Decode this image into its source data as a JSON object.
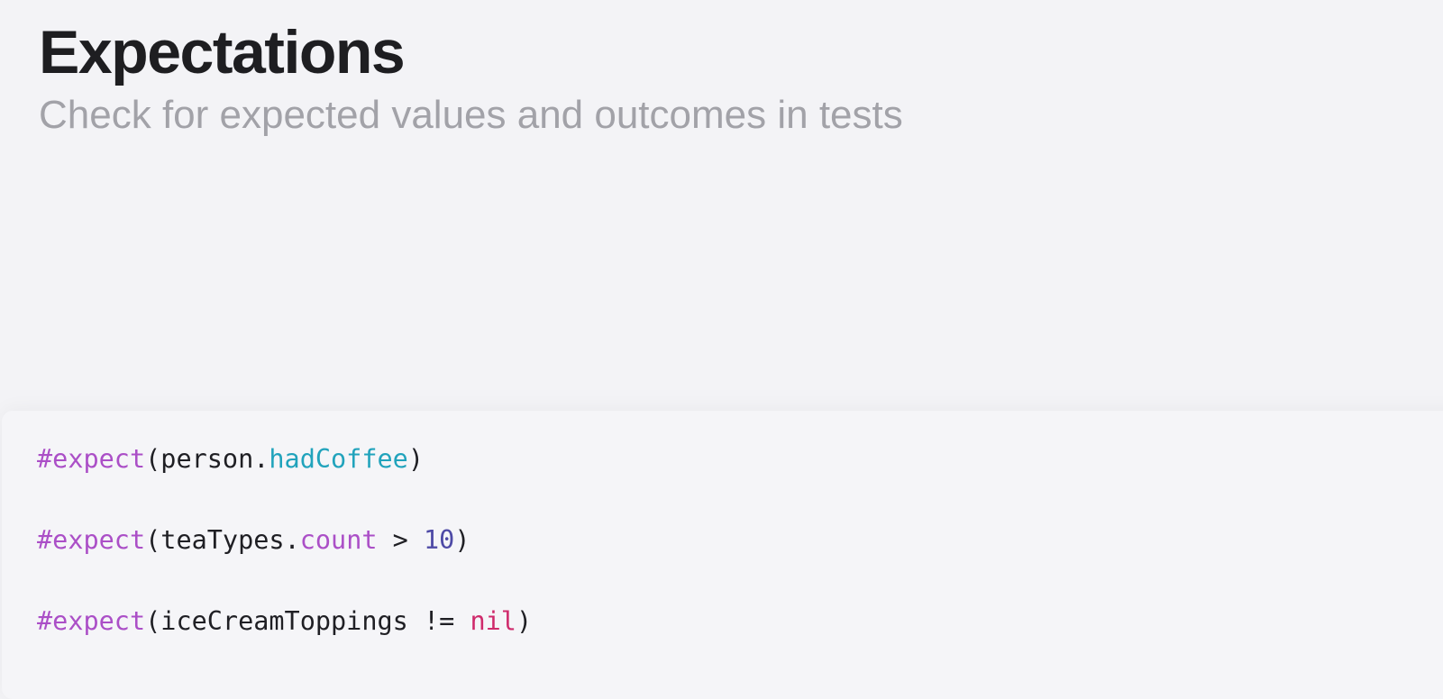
{
  "header": {
    "title": "Expectations",
    "subtitle": "Check for expected values and outcomes in tests"
  },
  "code": {
    "lines": [
      {
        "macro": "#expect",
        "open": "(",
        "object": "person.",
        "property": "hadCoffee",
        "close": ")"
      },
      {
        "macro": "#expect",
        "open": "(",
        "object": "teaTypes.",
        "property": "count",
        "operator": " > ",
        "number": "10",
        "close": ")"
      },
      {
        "macro": "#expect",
        "open": "(",
        "object": "iceCreamToppings",
        "operator": " != ",
        "keyword": "nil",
        "close": ")"
      }
    ]
  },
  "colors": {
    "background": "#f3f3f6",
    "title": "#1e1e21",
    "subtitle": "#a2a2a8",
    "macro": "#ab4fc7",
    "property_hadCoffee": "#21a3bc",
    "property_count": "#ab4fc7",
    "number": "#4e4aa6",
    "keyword": "#cf2a6b",
    "plain_code": "#1f1f24"
  }
}
